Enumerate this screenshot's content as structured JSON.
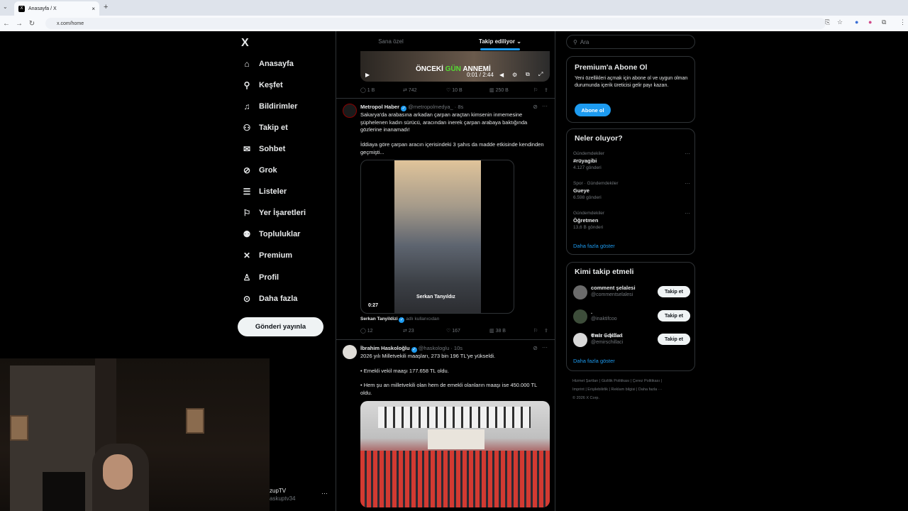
{
  "browser": {
    "tab_title": "Anasayfa / X",
    "url": "x.com/home",
    "new_tab": "+",
    "close": "×"
  },
  "sidebar": {
    "logo": "X",
    "items": [
      {
        "label": "Anasayfa",
        "icon": "home-icon"
      },
      {
        "label": "Keşfet",
        "icon": "search-icon"
      },
      {
        "label": "Bildirimler",
        "icon": "bell-icon"
      },
      {
        "label": "Takip et",
        "icon": "person-add-icon"
      },
      {
        "label": "Sohbet",
        "icon": "mail-icon"
      },
      {
        "label": "Grok",
        "icon": "grok-icon"
      },
      {
        "label": "Listeler",
        "icon": "list-icon"
      },
      {
        "label": "Yer İşaretleri",
        "icon": "bookmark-icon"
      },
      {
        "label": "Topluluklar",
        "icon": "people-icon"
      },
      {
        "label": "Premium",
        "icon": "x-icon"
      },
      {
        "label": "Profil",
        "icon": "person-icon"
      },
      {
        "label": "Daha fazla",
        "icon": "more-circle-icon"
      }
    ],
    "post_button": "Gönderi yayınla",
    "profile": {
      "name": "zupTV",
      "handle": "askuptv34",
      "more": "···"
    }
  },
  "feed": {
    "tabs": [
      {
        "label": "Sana özel"
      },
      {
        "label": "Takip ediliyor ⌄"
      }
    ],
    "top_video": {
      "title_pre": "ÖNCEKİ ",
      "title_green": "GÜN",
      "title_post": " ANNEMİ",
      "time": "0:01 / 2:44",
      "play": "▶"
    },
    "top_actions": {
      "reply": "1 B",
      "repost": "742",
      "like": "10 B",
      "views": "250 B"
    },
    "tweet1": {
      "name": "Metropol Haber",
      "handle": "@metropolmedya_ · 8s",
      "text1": "Sakarya'da arabasına arkadan çarpan araçtan kimsenin inmemesine şüphelenen kadın sürücü, aracından inerek çarpan arabaya baktığında gözlerine inanamadı!",
      "text2": "İddiaya göre çarpan aracın içerisindeki 3 şahıs da madde etkisinde kendinden geçmişti...",
      "video_time": "0:27",
      "caption": "Serkan Tanyıldız",
      "attrib_name": "Serkan Tanyildizi",
      "attrib_sub": "adlı kullanıcıdan",
      "actions": {
        "reply": "12",
        "repost": "23",
        "like": "167",
        "views": "38 B"
      }
    },
    "tweet2": {
      "name": "İbrahim Haskoloğlu",
      "handle": "@haskologlu · 10s",
      "text1": "2026 yılı Milletvekili maaşları, 273 bin 196 TL'ye yükseldi.",
      "text2": "• Emekli vekil maaşı 177.658 TL oldu.",
      "text3": "• Hem şu an milletvekili olan hem de emekli olanların maaşı ise 450.000 TL oldu."
    }
  },
  "right": {
    "search_placeholder": "Ara",
    "premium": {
      "title": "Premium'a Abone Ol",
      "text": "Yeni özellikleri açmak için abone ol ve uygun olman durumunda içerik üreticisi gelir payı kazan.",
      "button": "Abone ol"
    },
    "trends": {
      "title": "Neler oluyor?",
      "items": [
        {
          "cat": "Gündemdekiler",
          "name": "#rüyagibi",
          "posts": "4.127 gönderi"
        },
        {
          "cat": "Spor · Gündemdekiler",
          "name": "Gueye",
          "posts": "6.598 gönderi"
        },
        {
          "cat": "Gündemdekiler",
          "name": "Öğretmen",
          "posts": "13,6 B gönderi"
        }
      ],
      "more": "Daha fazla göster"
    },
    "who": {
      "title": "Kimi takip etmeli",
      "items": [
        {
          "name": "comment şelalesi",
          "handle": "@commentselalesi",
          "button": "Takip et"
        },
        {
          "name": ".",
          "handle": "@inaktifcoo",
          "button": "Takip et"
        },
        {
          "name": "𝕰𝖒𝖎𝖗 𝕾𝖈𝖍𝖎𝖑𝖑𝖆𝖈𝖎",
          "handle": "@emirschillaci",
          "button": "Takip et"
        }
      ],
      "more": "Daha fazla göster"
    },
    "footer": {
      "line1": "Hizmet Şartları  |  Gizlilik Politikası  |  Çerez Politikası  |",
      "line2": "Imprint  |  Erişilebilirlik  |  Reklam bilgisi  |  Daha fazla ···",
      "line3": "© 2026 X Corp."
    }
  }
}
